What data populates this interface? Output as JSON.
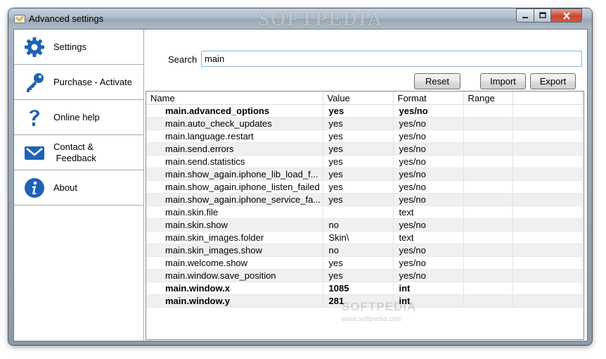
{
  "window": {
    "title": "Advanced settings",
    "watermark": "SOFTPEDIA"
  },
  "sidebar": {
    "items": [
      {
        "label": "Settings",
        "icon": "gear-icon"
      },
      {
        "label": "Purchase - Activate",
        "icon": "key-icon"
      },
      {
        "label": "Online help",
        "icon": "question-icon"
      },
      {
        "label": "Contact &\n Feedback",
        "icon": "envelope-icon"
      },
      {
        "label": "About",
        "icon": "info-icon"
      }
    ]
  },
  "search": {
    "label": "Search",
    "value": "main"
  },
  "buttons": {
    "reset": "Reset",
    "import": "Import",
    "export": "Export"
  },
  "table": {
    "columns": [
      "Name",
      "Value",
      "Format",
      "Range"
    ],
    "rows": [
      {
        "name": "main.advanced_options",
        "value": "yes",
        "format": "yes/no",
        "range": "",
        "bold": true
      },
      {
        "name": "main.auto_check_updates",
        "value": "yes",
        "format": "yes/no",
        "range": "",
        "bold": false
      },
      {
        "name": "main.language.restart",
        "value": "yes",
        "format": "yes/no",
        "range": "",
        "bold": false
      },
      {
        "name": "main.send.errors",
        "value": "yes",
        "format": "yes/no",
        "range": "",
        "bold": false
      },
      {
        "name": "main.send.statistics",
        "value": "yes",
        "format": "yes/no",
        "range": "",
        "bold": false
      },
      {
        "name": "main.show_again.iphone_lib_load_f...",
        "value": "yes",
        "format": "yes/no",
        "range": "",
        "bold": false
      },
      {
        "name": "main.show_again.iphone_listen_failed",
        "value": "yes",
        "format": "yes/no",
        "range": "",
        "bold": false
      },
      {
        "name": "main.show_again.iphone_service_fa...",
        "value": "yes",
        "format": "yes/no",
        "range": "",
        "bold": false
      },
      {
        "name": "main.skin.file",
        "value": "",
        "format": "text",
        "range": "",
        "bold": false
      },
      {
        "name": "main.skin.show",
        "value": "no",
        "format": "yes/no",
        "range": "",
        "bold": false
      },
      {
        "name": "main.skin_images.folder",
        "value": "Skin\\",
        "format": "text",
        "range": "",
        "bold": false
      },
      {
        "name": "main.skin_images.show",
        "value": "no",
        "format": "yes/no",
        "range": "",
        "bold": false
      },
      {
        "name": "main.welcome.show",
        "value": "yes",
        "format": "yes/no",
        "range": "",
        "bold": false
      },
      {
        "name": "main.window.save_position",
        "value": "yes",
        "format": "yes/no",
        "range": "",
        "bold": false
      },
      {
        "name": "main.window.x",
        "value": "1085",
        "format": "int",
        "range": "",
        "bold": true
      },
      {
        "name": "main.window.y",
        "value": "281",
        "format": "int",
        "range": "",
        "bold": true
      }
    ]
  },
  "grid_watermark": {
    "brand": "SOFTPEDIA",
    "url": "www.softpedia.com"
  },
  "colors": {
    "settings_icon": "#1f62b5",
    "key_icon": "#1f62b5",
    "question_icon": "#1f62b5",
    "envelope_icon": "#1f62b5",
    "info_icon": "#1f62b5",
    "alt_row": "#f0f0f0",
    "close_button": "#c7462f"
  }
}
